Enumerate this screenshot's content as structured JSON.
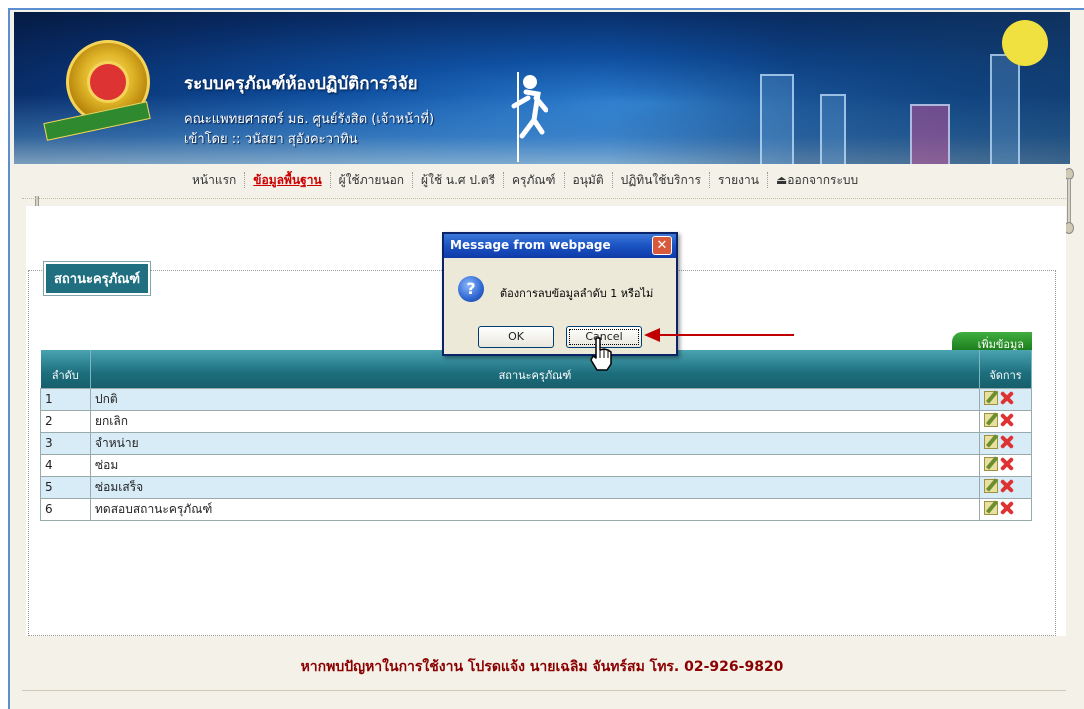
{
  "header": {
    "system_title": "ระบบครุภัณฑ์ห้องปฏิบัติการวิจัย",
    "faculty": "คณะแพทยศาสตร์ มธ. ศูนย์รังสิต (เจ้าหน้าที่)",
    "login_label": "เข้าโดย :: วนัสยา สุอังคะวาทิน"
  },
  "nav": {
    "items": [
      {
        "label": "หน้าแรก",
        "active": false
      },
      {
        "label": "ข้อมูลพื้นฐาน",
        "active": true
      },
      {
        "label": "ผู้ใช้ภายนอก",
        "active": false
      },
      {
        "label": "ผู้ใช้ น.ศ ป.ตรี",
        "active": false
      },
      {
        "label": "ครุภัณฑ์",
        "active": false
      },
      {
        "label": "อนุมัติ",
        "active": false
      },
      {
        "label": "ปฏิทินใช้บริการ",
        "active": false
      },
      {
        "label": "รายงาน",
        "active": false
      },
      {
        "label": "ออกจากระบบ",
        "active": false
      }
    ]
  },
  "section": {
    "legend": "สถานะครุภัณฑ์",
    "add_label": "เพิ่มข้อมูล"
  },
  "table": {
    "headers": [
      "ลำดับ",
      "สถานะครุภัณฑ์",
      "จัดการ"
    ],
    "rows": [
      {
        "no": "1",
        "name": "ปกติ"
      },
      {
        "no": "2",
        "name": "ยกเลิก"
      },
      {
        "no": "3",
        "name": "จำหน่าย"
      },
      {
        "no": "4",
        "name": "ซ่อม"
      },
      {
        "no": "5",
        "name": "ซ่อมเสร็จ"
      },
      {
        "no": "6",
        "name": "ทดสอบสถานะครุภัณฑ์"
      }
    ]
  },
  "footer": {
    "message": "หากพบปัญหาในการใช้งาน โปรดแจ้ง นายเฉลิม จันทร์สม โทร. 02-926-9820"
  },
  "dialog": {
    "title": "Message from webpage",
    "message": "ต้องการลบข้อมูลลำดับ 1 หรือไม่",
    "ok_label": "OK",
    "cancel_label": "Cancel",
    "close_glyph": "✕",
    "icon_glyph": "?"
  },
  "colors": {
    "header_blue": "#0f4fa0",
    "table_header": "#1d6f7e",
    "row_highlight": "#d8ecf8",
    "footer_text": "#8b0000",
    "active_nav": "#cc0000",
    "add_button": "#1a7a1a",
    "arrow": "#c00000"
  }
}
